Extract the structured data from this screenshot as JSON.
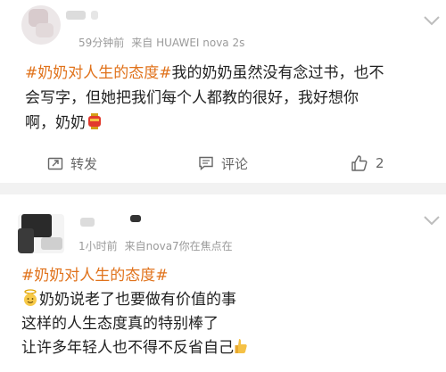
{
  "post1": {
    "meta": {
      "time": "59分钟前",
      "source": "来自 HUAWEI nova 2s"
    },
    "topic": "#奶奶对人生的态度#",
    "text_line1": "我的奶奶虽然没有念过书，也不",
    "text_line2": "会写字，但她把我们每个人都教的很好，我好想你",
    "text_line3": "啊，奶奶",
    "emoji": "red-lantern-emoji",
    "actions": {
      "repost": "转发",
      "comment": "评论",
      "like_count": "2"
    }
  },
  "post2": {
    "meta": {
      "time": "1小时前",
      "source": "来自nova7你在焦点在"
    },
    "topic": "#奶奶对人生的态度#",
    "line1": "奶奶说老了也要做有价值的事",
    "line2": "这样的人生态度真的特别棒了",
    "line3": "让许多年轻人也不得不反省自己",
    "emoji_start": "angel-face-emoji",
    "emoji_end": "thumbs-up-emoji"
  },
  "colors": {
    "topic": "#e0721b",
    "meta": "#9a9a9a",
    "text": "#222222",
    "divider": "#f2f2f2"
  }
}
